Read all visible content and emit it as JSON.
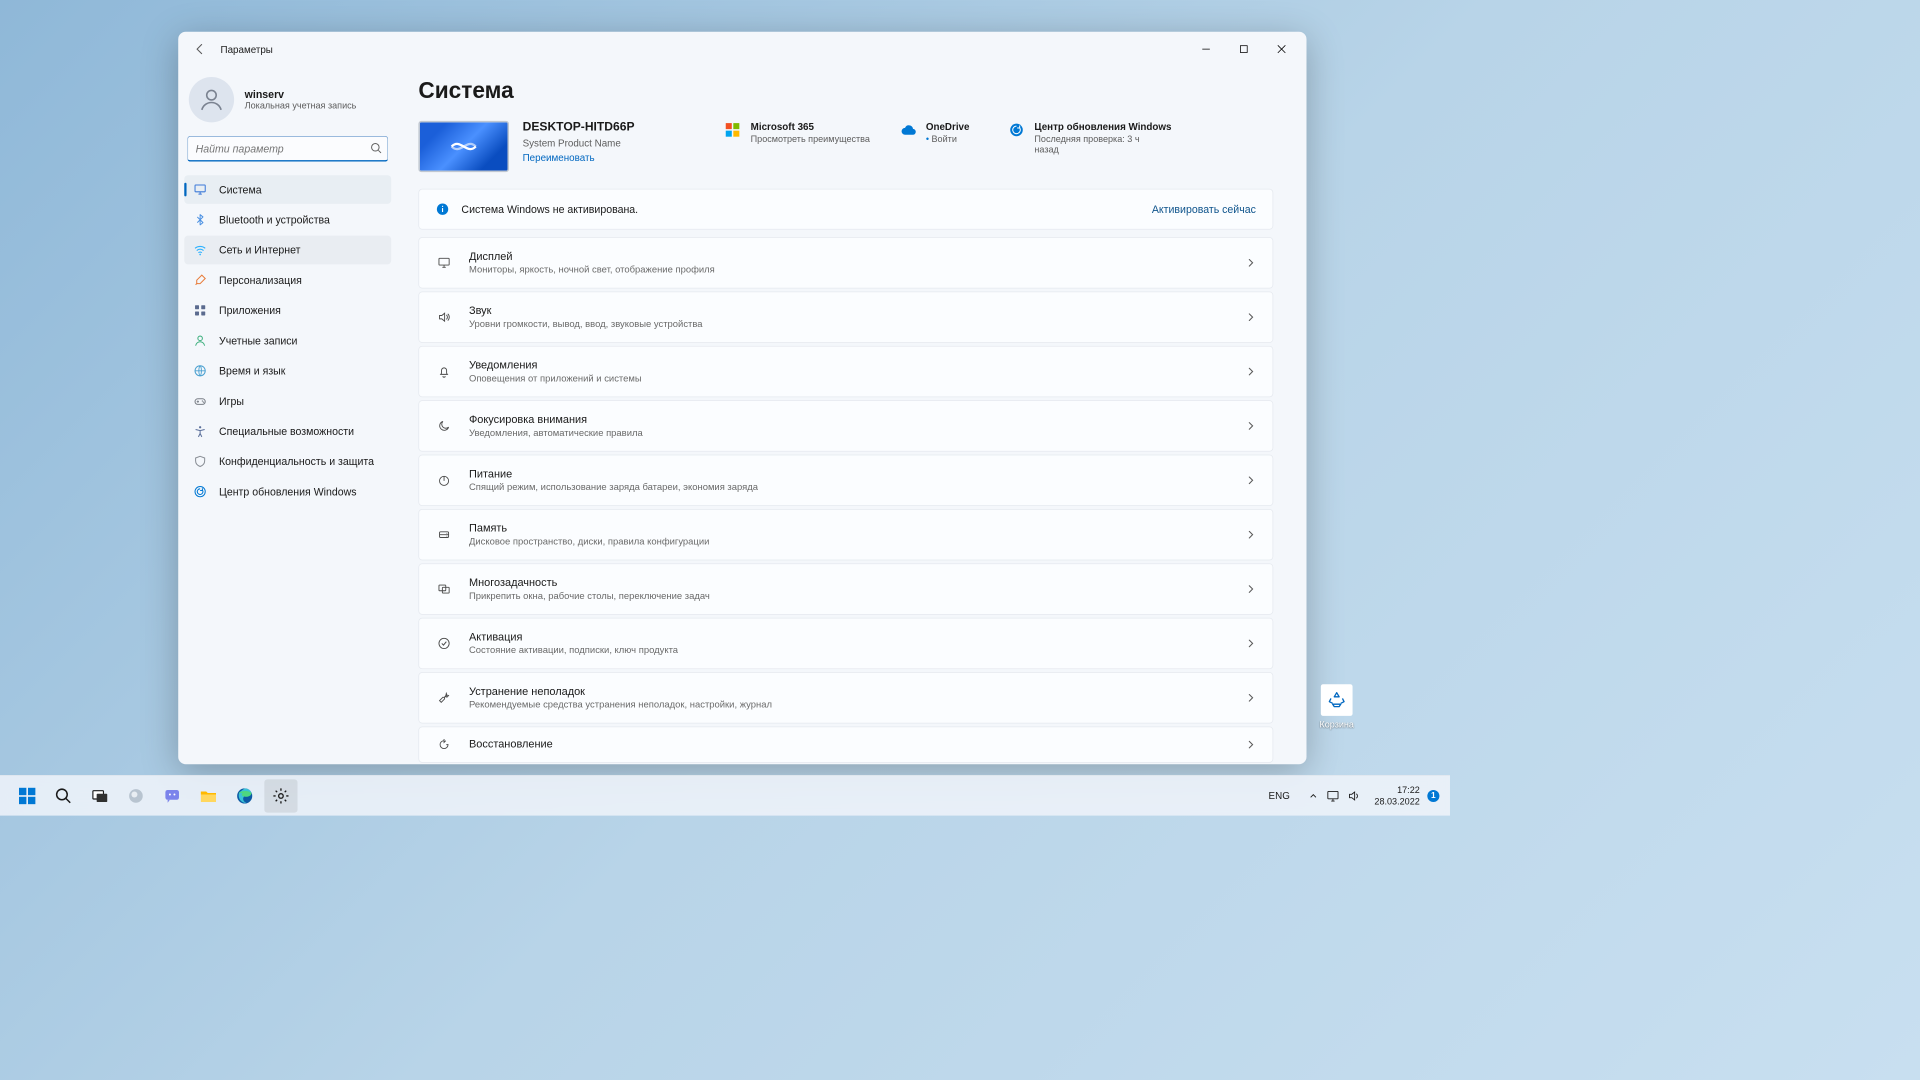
{
  "window": {
    "title": "Параметры"
  },
  "account": {
    "name": "winserv",
    "type": "Локальная учетная запись"
  },
  "search": {
    "placeholder": "Найти параметр"
  },
  "nav": [
    {
      "label": "Система",
      "icon": "monitor",
      "color": "#3b78d8",
      "active": true
    },
    {
      "label": "Bluetooth и устройства",
      "icon": "bluetooth",
      "color": "#4a90e2"
    },
    {
      "label": "Сеть и Интернет",
      "icon": "wifi",
      "color": "#2eb2ff",
      "hover": true
    },
    {
      "label": "Персонализация",
      "icon": "brush",
      "color": "#e87c3a"
    },
    {
      "label": "Приложения",
      "icon": "apps",
      "color": "#5b6b8f"
    },
    {
      "label": "Учетные записи",
      "icon": "user",
      "color": "#3fb07f"
    },
    {
      "label": "Время и язык",
      "icon": "globe",
      "color": "#4aa0d0"
    },
    {
      "label": "Игры",
      "icon": "game",
      "color": "#7a7f87"
    },
    {
      "label": "Специальные возможности",
      "icon": "accessibility",
      "color": "#5a6f9a"
    },
    {
      "label": "Конфиденциальность и защита",
      "icon": "shield",
      "color": "#8a8f96"
    },
    {
      "label": "Центр обновления Windows",
      "icon": "update",
      "color": "#0078d4"
    }
  ],
  "page": {
    "title": "Система",
    "device_name": "DESKTOP-HITD66P",
    "device_sub": "System Product Name",
    "rename": "Переименовать"
  },
  "hero": {
    "m365": {
      "title": "Microsoft 365",
      "sub": "Просмотреть преимущества"
    },
    "onedrive": {
      "title": "OneDrive",
      "sub": "Войти",
      "bullet": "•"
    },
    "wu": {
      "title": "Центр обновления Windows",
      "sub": "Последняя проверка: 3 ч назад"
    }
  },
  "banner": {
    "msg": "Система Windows не активирована.",
    "action": "Активировать сейчас"
  },
  "rows": [
    {
      "icon": "display",
      "title": "Дисплей",
      "sub": "Мониторы, яркость, ночной свет, отображение профиля"
    },
    {
      "icon": "sound",
      "title": "Звук",
      "sub": "Уровни громкости, вывод, ввод, звуковые устройства"
    },
    {
      "icon": "bell",
      "title": "Уведомления",
      "sub": "Оповещения от приложений и системы"
    },
    {
      "icon": "moon",
      "title": "Фокусировка внимания",
      "sub": "Уведомления, автоматические правила"
    },
    {
      "icon": "power",
      "title": "Питание",
      "sub": "Спящий режим, использование заряда батареи, экономия заряда"
    },
    {
      "icon": "storage",
      "title": "Память",
      "sub": "Дисковое пространство, диски, правила конфигурации"
    },
    {
      "icon": "multi",
      "title": "Многозадачность",
      "sub": "Прикрепить окна, рабочие столы, переключение задач"
    },
    {
      "icon": "key",
      "title": "Активация",
      "sub": "Состояние активации, подписки, ключ продукта"
    },
    {
      "icon": "wrench",
      "title": "Устранение неполадок",
      "sub": "Рекомендуемые средства устранения неполадок, настройки, журнал"
    },
    {
      "icon": "recover",
      "title": "Восстановление",
      "sub": ""
    }
  ],
  "desktop": {
    "recycle": "Корзина"
  },
  "taskbar": {
    "lang": "ENG",
    "time": "17:22",
    "date": "28.03.2022"
  }
}
